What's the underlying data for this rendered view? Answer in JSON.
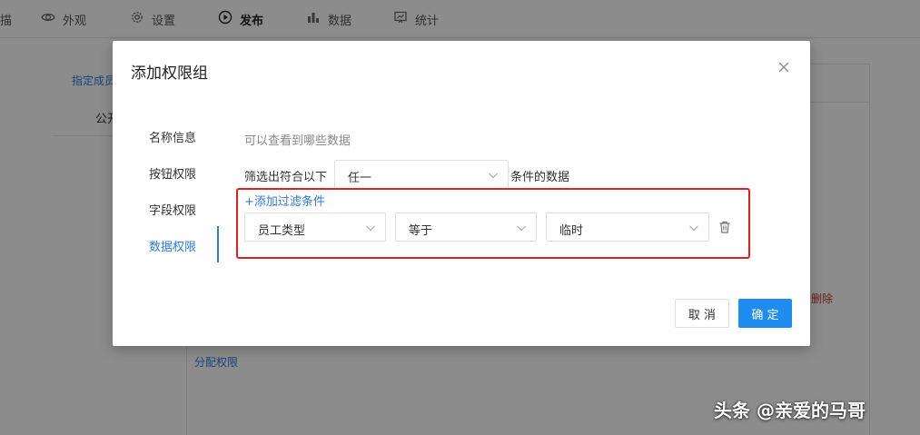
{
  "topnav": {
    "edge_label": "描",
    "items": [
      {
        "label": "外观",
        "icon": "eye-icon"
      },
      {
        "label": "设置",
        "icon": "gear-icon"
      },
      {
        "label": "发布",
        "icon": "play-circle-icon",
        "active": true
      },
      {
        "label": "数据",
        "icon": "bar-chart-icon"
      },
      {
        "label": "统计",
        "icon": "presentation-chart-icon"
      }
    ]
  },
  "background": {
    "left_link": "指定成员",
    "left_text": "公开",
    "delete_text": "删除",
    "assign_link": "分配权限"
  },
  "modal": {
    "title": "添加权限组",
    "tabs": [
      {
        "label": "名称信息",
        "active": false
      },
      {
        "label": "按钮权限",
        "active": false
      },
      {
        "label": "字段权限",
        "active": false
      },
      {
        "label": "数据权限",
        "active": true
      }
    ],
    "hint": "可以查看到哪些数据",
    "filter_prefix": "筛选出符合以下",
    "match_select": "任一",
    "filter_suffix": "条件的数据",
    "add_filter": "+添加过滤条件",
    "condition": {
      "field": "员工类型",
      "operator": "等于",
      "value": "临时"
    },
    "cancel_label": "取 消",
    "ok_label": "确 定"
  },
  "watermark": "头条 @亲爱的马哥",
  "colors": {
    "accent": "#2c7be5",
    "primary_button": "#1e8cf0",
    "highlight_border": "#e02020",
    "danger_text": "#c0392b"
  }
}
